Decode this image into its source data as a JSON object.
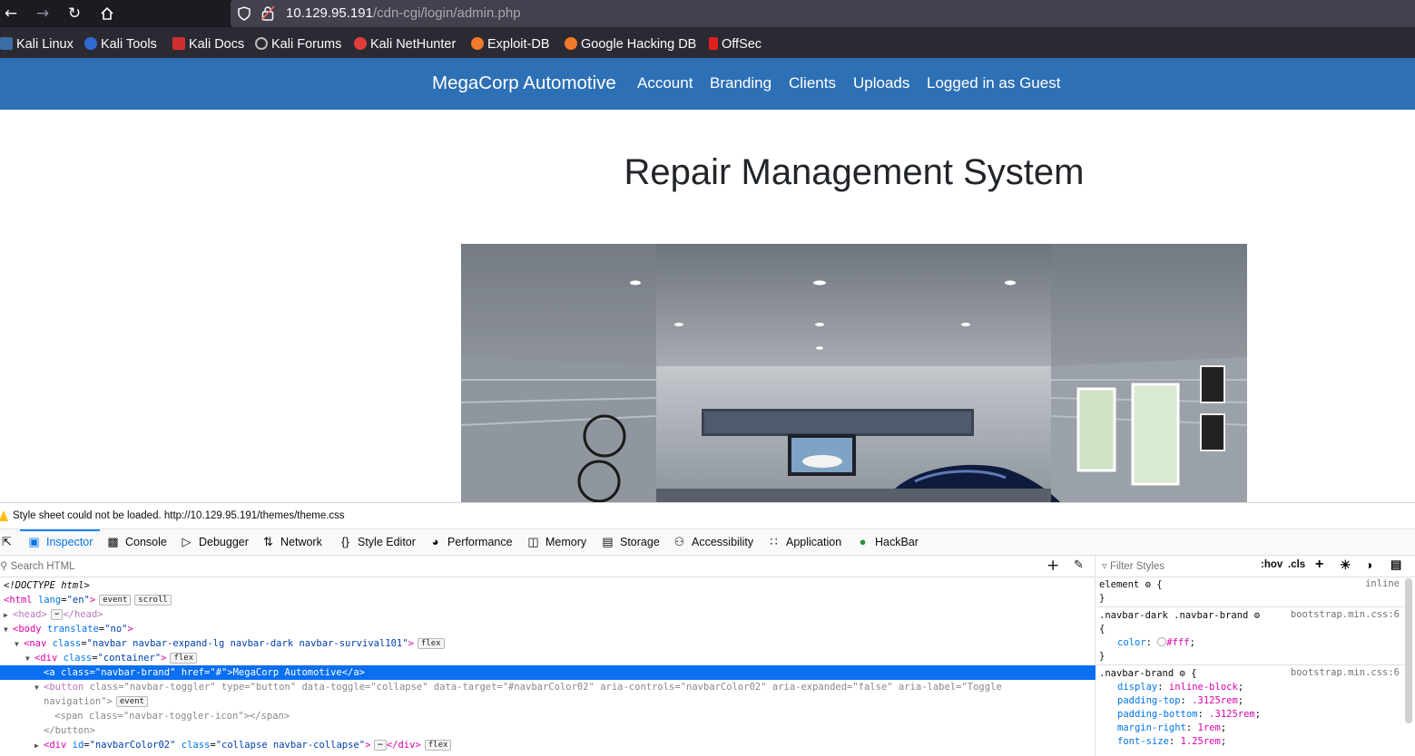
{
  "browser": {
    "url_host": "10.129.95.191",
    "url_path": "/cdn-cgi/login/admin.php",
    "bookmarks": [
      "Kali Linux",
      "Kali Tools",
      "Kali Docs",
      "Kali Forums",
      "Kali NetHunter",
      "Exploit-DB",
      "Google Hacking DB",
      "OffSec"
    ]
  },
  "site": {
    "brand": "MegaCorp Automotive",
    "nav": [
      "Account",
      "Branding",
      "Clients",
      "Uploads",
      "Logged in as Guest"
    ],
    "title": "Repair Management System",
    "colors": {
      "navbar": "#2d70b5"
    }
  },
  "devtools": {
    "warning": "Style sheet could not be loaded. http://10.129.95.191/themes/theme.css",
    "tabs": [
      "Inspector",
      "Console",
      "Debugger",
      "Network",
      "Style Editor",
      "Performance",
      "Memory",
      "Storage",
      "Accessibility",
      "Application",
      "HackBar"
    ],
    "search_placeholder": "Search HTML",
    "filter_placeholder": "Filter Styles",
    "hov": ":hov",
    "cls": ".cls",
    "badges": {
      "event": "event",
      "scroll": "scroll",
      "flex": "flex"
    },
    "tree": {
      "doctype": "<!DOCTYPE html>",
      "html_open": "<html",
      "html_attr": "lang",
      "html_val": "\"en\"",
      "head_line": "<head>",
      "head_close": "</head>",
      "body_open": "<body",
      "body_attr": "translate",
      "body_val": "\"no\"",
      "nav_open": "<nav",
      "nav_attr": "class",
      "nav_val": "\"navbar navbar-expand-lg navbar-dark navbar-survival101\"",
      "div_open": "<div",
      "div_attr": "class",
      "div_val": "\"container\"",
      "selected": "<a class=\"navbar-brand\" href=\"#\">MegaCorp Automotive</a>",
      "button_open": "<button",
      "button_attrs": " class=\"navbar-toggler\" type=\"button\" data-toggle=\"collapse\" data-target=\"#navbarColor02\" aria-controls=\"navbarColor02\" aria-expanded=\"false\" aria-label=\"Toggle",
      "button_cont": "navigation\">",
      "span_line": "<span class=\"navbar-toggler-icon\"></span>",
      "button_close": "</button>",
      "div2_open": "<div",
      "div2_attr1": "id",
      "div2_val1": "\"navbarColor02\"",
      "div2_attr2": "class",
      "div2_val2": "\"collapse navbar-collapse\"",
      "div2_close": "</div>"
    },
    "rules": {
      "element_selector": "element",
      "element_src": "inline",
      "r1_selector": ".navbar-dark .navbar-brand",
      "r1_src": "bootstrap.min.css:6",
      "r1_prop": "color",
      "r1_val": "#fff",
      "r2_selector": ".navbar-brand",
      "r2_src": "bootstrap.min.css:6",
      "r2_props": [
        {
          "p": "display",
          "v": "inline-block"
        },
        {
          "p": "padding-top",
          "v": ".3125rem"
        },
        {
          "p": "padding-bottom",
          "v": ".3125rem"
        },
        {
          "p": "margin-right",
          "v": "1rem"
        },
        {
          "p": "font-size",
          "v": "1.25rem"
        }
      ]
    }
  }
}
